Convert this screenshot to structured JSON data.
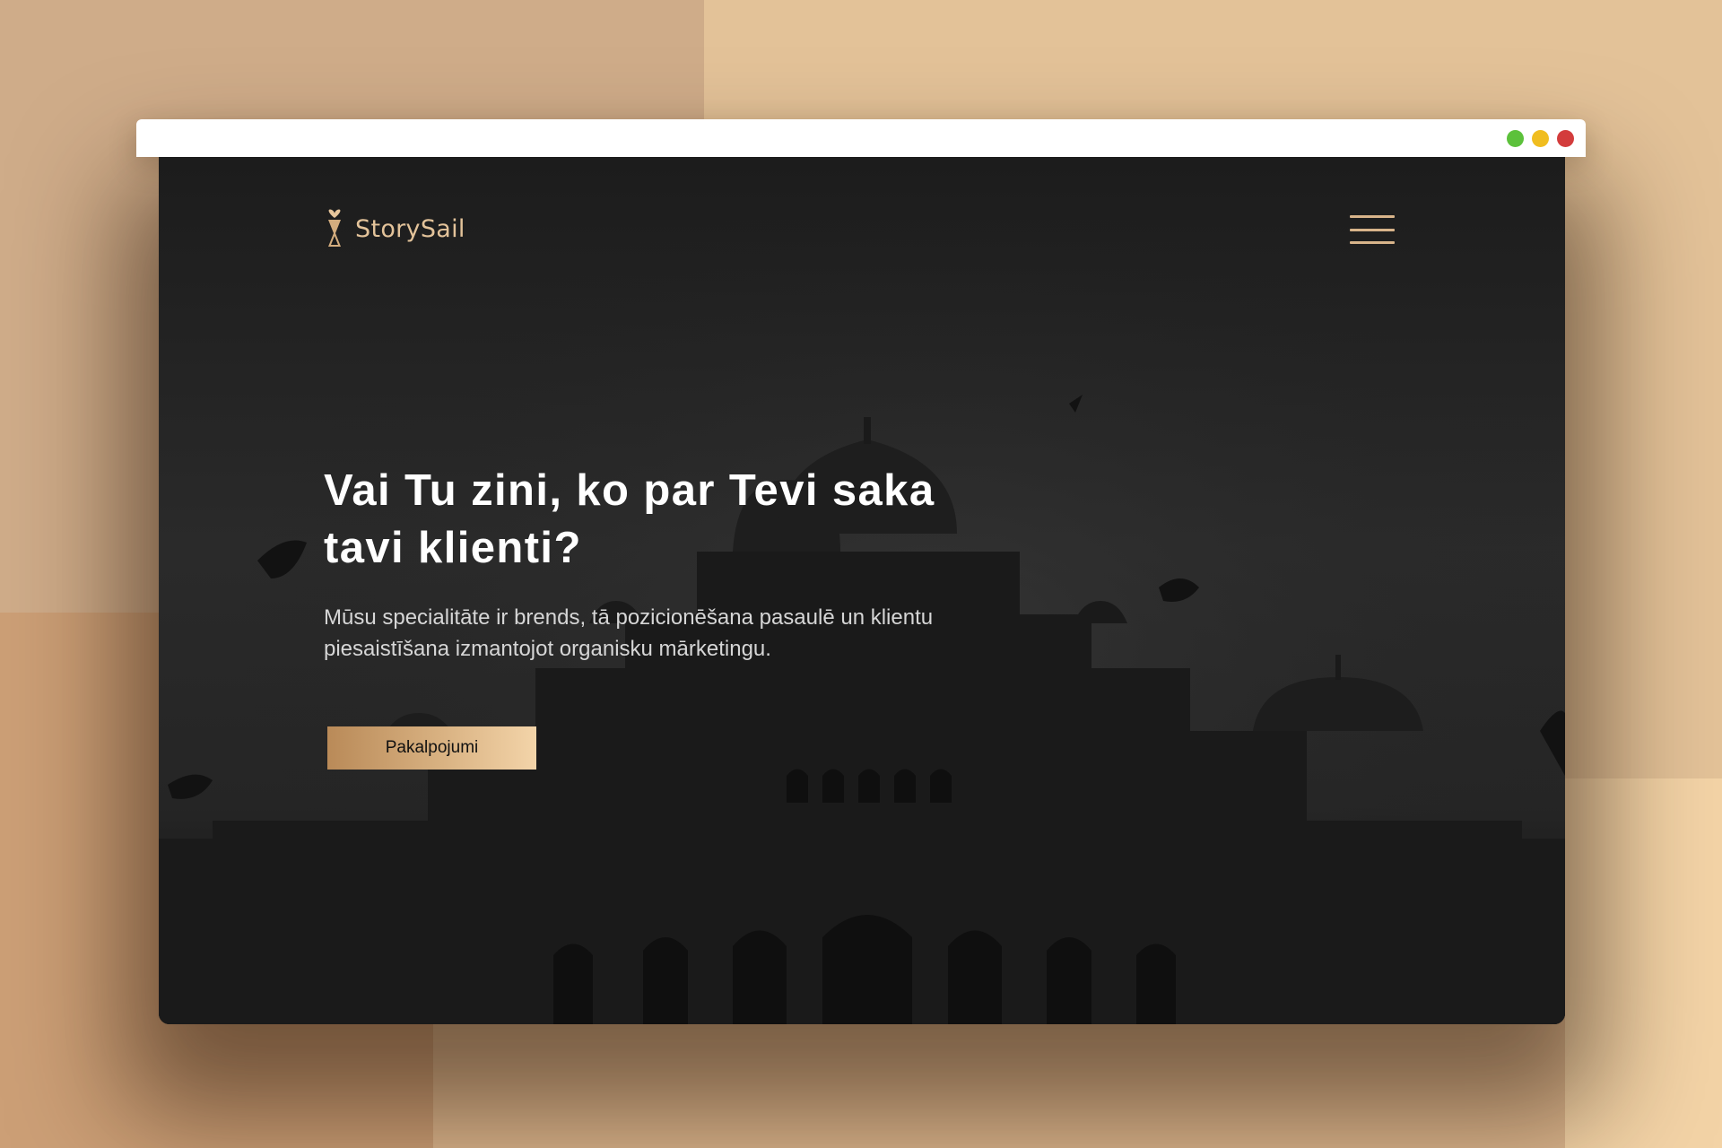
{
  "brand": {
    "name": "StorySail"
  },
  "window_controls": {
    "green": "#5cc13b",
    "yellow": "#f0bd1f",
    "red": "#d33c3c"
  },
  "hero": {
    "title_line1": "Vai Tu zini, ko par Tevi saka",
    "title_line2": "tavi klienti?",
    "subtitle": "Mūsu specialitāte ir brends, tā pozicionēšana pasaulē un klientu piesaistīšana izmantojot organisku mārketingu."
  },
  "cta": {
    "label": "Pakalpojumi"
  },
  "icons": {
    "menu": "hamburger-menu-icon",
    "logo": "hourglass-heart-logo-icon"
  },
  "colors": {
    "accent": "#d8b48a",
    "hero_bg": "#222222"
  }
}
